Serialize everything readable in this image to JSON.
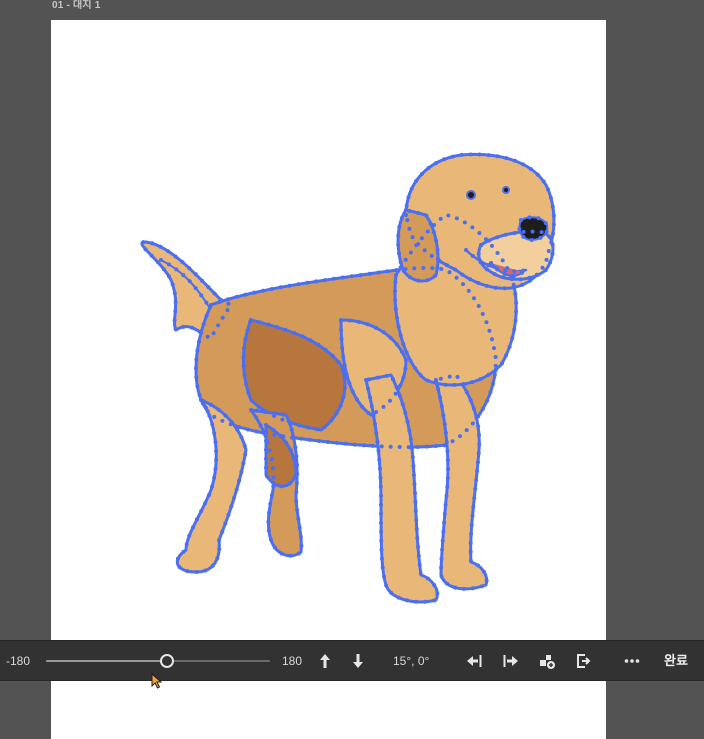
{
  "artboard": {
    "label": "01 - 대지 1"
  },
  "toolbar": {
    "slider": {
      "min_label": "-180",
      "max_label": "180",
      "min": -180,
      "max": 180,
      "value": 15
    },
    "angle_readout": "15°, 0°",
    "done_label": "완료"
  },
  "icons": {
    "move_up": "arrow-up-icon",
    "move_down": "arrow-down-icon",
    "align_left": "align-left-icon",
    "align_right": "align-right-icon",
    "share": "share-icon",
    "export": "export-icon",
    "more": "more-icon"
  },
  "colors": {
    "canvas_bg": "#535353",
    "toolbar_bg": "#323232",
    "selection_path": "#4a6ff0",
    "fur_light": "#e9b879",
    "fur_mid": "#d49a5a",
    "fur_dark": "#b7763d"
  }
}
